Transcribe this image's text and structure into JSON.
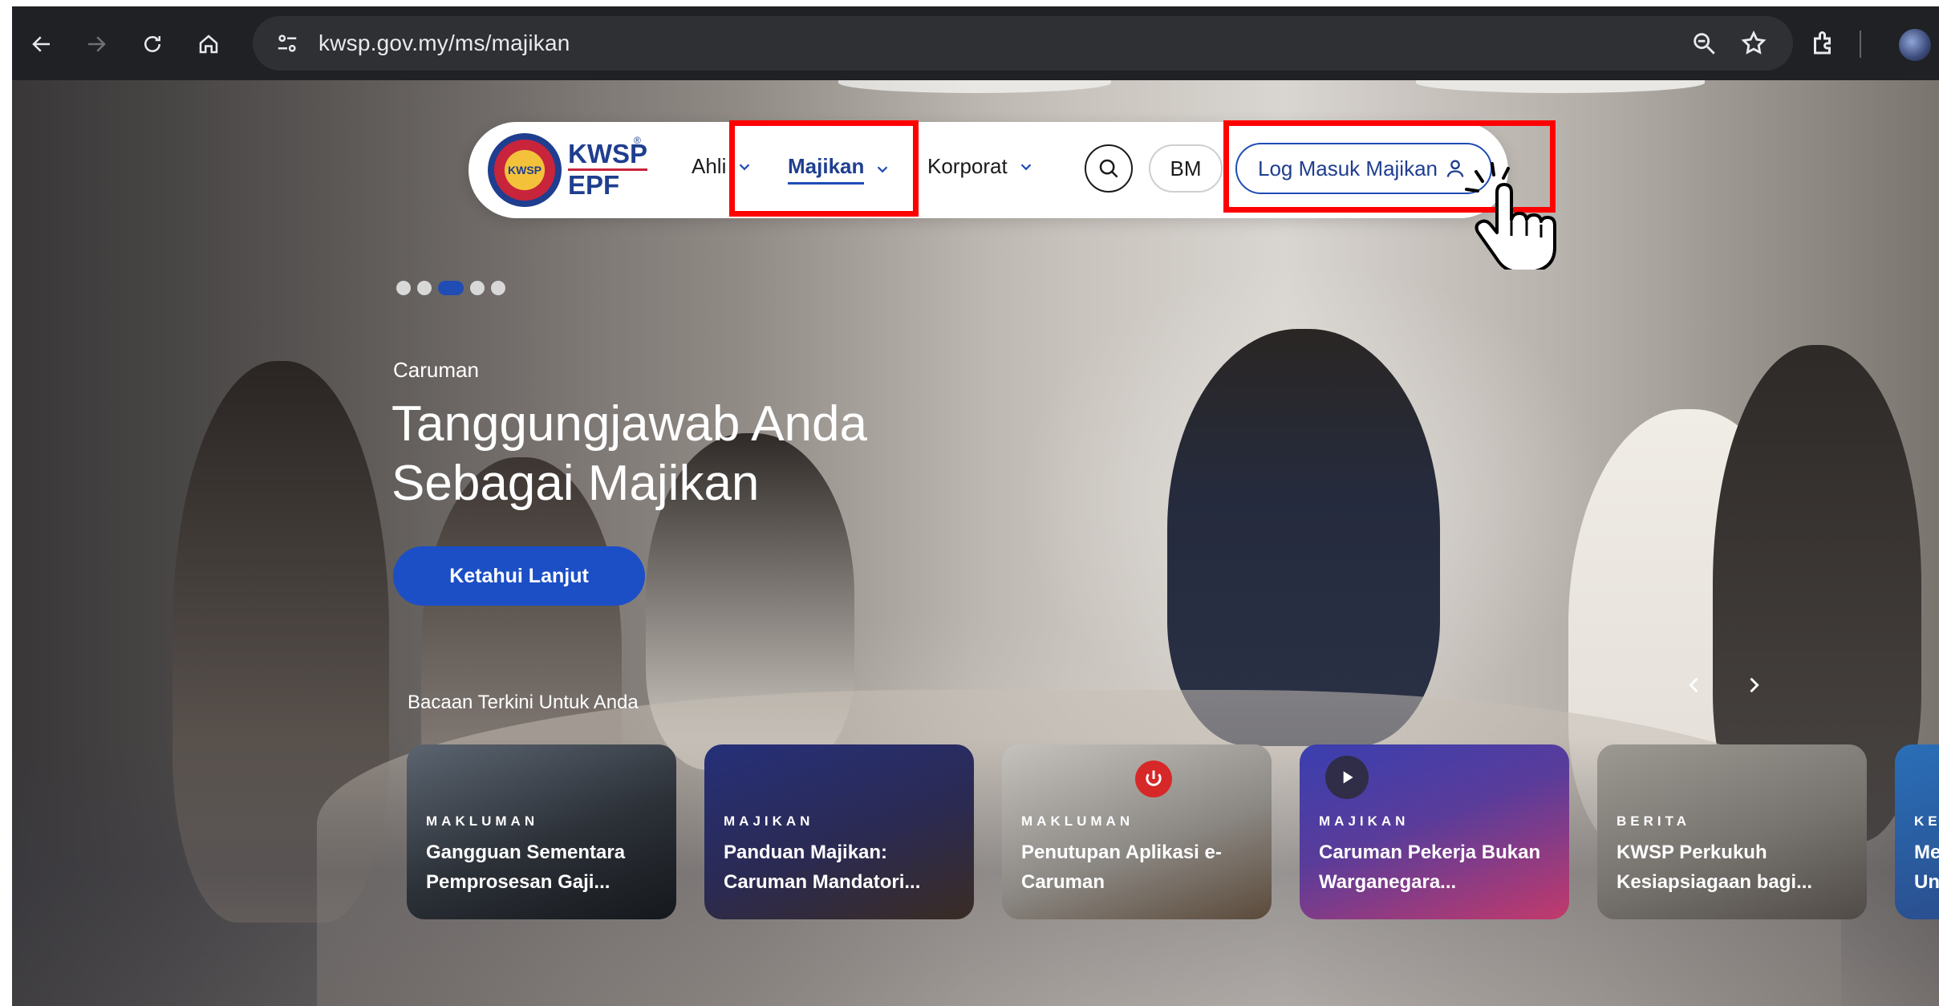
{
  "browser": {
    "url": "kwsp.gov.my/ms/majikan"
  },
  "site": {
    "logo": {
      "line1": "KWSP",
      "line2": "EPF",
      "reg": "®",
      "emblem_text": "KWSP"
    },
    "nav": {
      "ahli": "Ahli",
      "majikan": "Majikan",
      "korporat": "Korporat"
    },
    "lang": "BM",
    "login": "Log Masuk Majikan"
  },
  "hero": {
    "eyebrow": "Caruman",
    "headline": "Tanggungjawab Anda Sebagai Majikan",
    "cta": "Ketahui Lanjut",
    "dots": {
      "total": 5,
      "active_index": 2
    }
  },
  "reading": {
    "title": "Bacaan Terkini Untuk Anda",
    "cards": [
      {
        "category": "MAKLUMAN",
        "title": "Gangguan Sementara Pemprosesan Gaji..."
      },
      {
        "category": "MAJIKAN",
        "title": "Panduan Majikan: Caruman Mandatori..."
      },
      {
        "category": "MAKLUMAN",
        "title": "Penutupan Aplikasi e-Caruman"
      },
      {
        "category": "MAJIKAN",
        "title": "Caruman Pekerja Bukan Warganegara..."
      },
      {
        "category": "BERITA",
        "title": "KWSP Perkukuh Kesiapsiagaan bagi..."
      },
      {
        "category": "KE",
        "title": "Me Un"
      }
    ]
  },
  "colors": {
    "primary_blue": "#1c4fc6",
    "highlight_red": "#ff0000",
    "chrome_bg": "#202124"
  }
}
